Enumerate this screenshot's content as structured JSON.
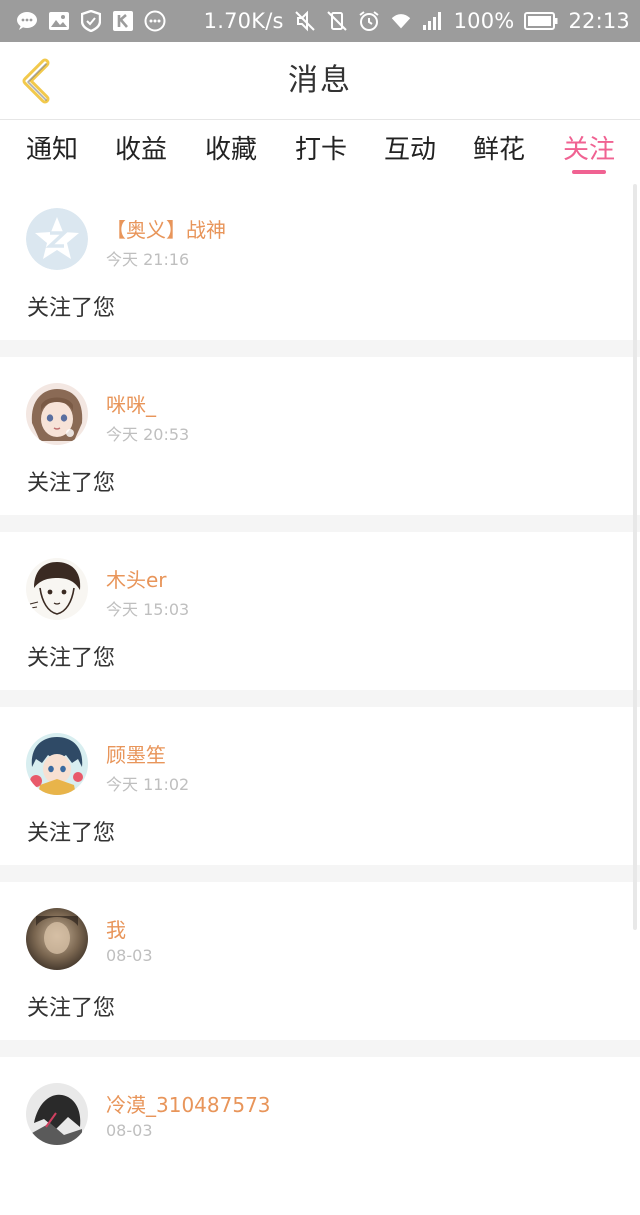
{
  "status_bar": {
    "speed": "1.70K/s",
    "battery": "100%",
    "time": "22:13"
  },
  "header": {
    "title": "消息"
  },
  "tabs": [
    {
      "label": "通知"
    },
    {
      "label": "收益"
    },
    {
      "label": "收藏"
    },
    {
      "label": "打卡"
    },
    {
      "label": "互动"
    },
    {
      "label": "鲜花"
    },
    {
      "label": "关注"
    }
  ],
  "active_tab": "关注",
  "colors": {
    "accent": "#f06292",
    "username": "#e8955a",
    "statusbar": "#9c9c9c"
  },
  "items": [
    {
      "name": "【奥义】战神",
      "time": "今天 21:16",
      "message": "关注了您"
    },
    {
      "name": "咪咪_",
      "time": "今天 20:53",
      "message": "关注了您"
    },
    {
      "name": "木头er",
      "time": "今天 15:03",
      "message": "关注了您"
    },
    {
      "name": "顾墨笙",
      "time": "今天 11:02",
      "message": "关注了您"
    },
    {
      "name": "我",
      "time": "08-03",
      "message": "关注了您"
    },
    {
      "name": "冷漠_310487573",
      "time": "08-03",
      "message": ""
    }
  ]
}
